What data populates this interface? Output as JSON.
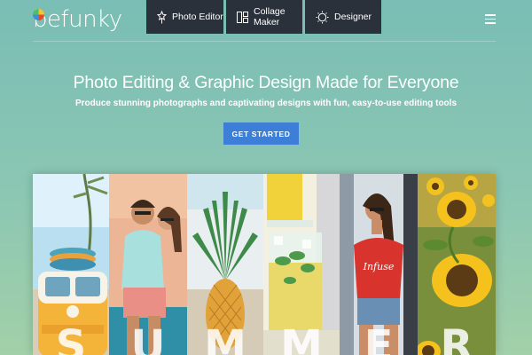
{
  "brand": {
    "name": "befunky"
  },
  "nav": {
    "photo_editor": "Photo Editor",
    "collage_maker": "Collage Maker",
    "designer": "Designer"
  },
  "hero": {
    "title": "Photo Editing & Graphic Design Made for Everyone",
    "subtitle": "Produce stunning photographs and captivating designs with fun, easy-to-use editing tools",
    "cta": "GET STARTED"
  },
  "collage": {
    "letters": [
      "S",
      "U",
      "M",
      "M",
      "E",
      "R"
    ],
    "shirt_text": "Infuse"
  },
  "colors": {
    "nav_bg": "#2b313a",
    "cta_bg": "#3d7fd6",
    "page_bg": "#84c3b5"
  },
  "icons": [
    "photo-editor-icon",
    "collage-maker-icon",
    "designer-icon",
    "hamburger-menu-icon"
  ]
}
